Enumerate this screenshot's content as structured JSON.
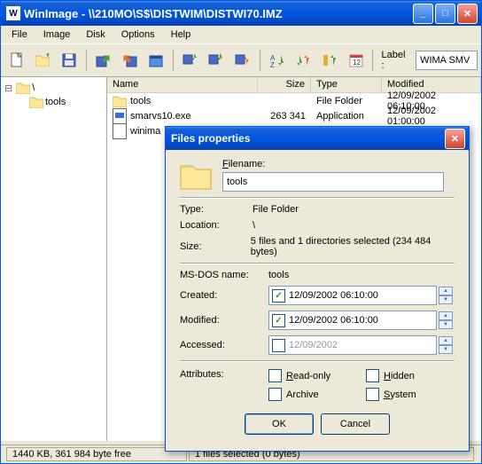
{
  "window": {
    "title": "WinImage - \\\\210MO\\S$\\DISTWIM\\DISTWI70.IMZ"
  },
  "menu": {
    "file": "File",
    "image": "Image",
    "disk": "Disk",
    "options": "Options",
    "help": "Help"
  },
  "toolbar": {
    "label_text": "Label :",
    "label_value": "WIMA SMV"
  },
  "tree": {
    "root": "\\",
    "child": "tools"
  },
  "list": {
    "headers": {
      "name": "Name",
      "size": "Size",
      "type": "Type",
      "modified": "Modified"
    },
    "rows": [
      {
        "name": "tools",
        "size": "",
        "type": "File Folder",
        "modified": "12/09/2002  06:10:00",
        "icon": "folder"
      },
      {
        "name": "smarvs10.exe",
        "size": "263 341",
        "type": "Application",
        "modified": "12/09/2002  01:00:00",
        "icon": "exe"
      },
      {
        "name": "winima",
        "size": "",
        "type": "",
        "modified": "",
        "icon": "imz"
      }
    ]
  },
  "status": {
    "left": "1440 KB, 361 984 byte free",
    "right": "1 files selected (0 bytes)"
  },
  "dialog": {
    "title": "Files properties",
    "filename_label": "Filename:",
    "filename_value": "tools",
    "type_label": "Type:",
    "type_value": "File Folder",
    "location_label": "Location:",
    "location_value": "\\",
    "size_label": "Size:",
    "size_value": "5 files and 1 directories selected (234 484 bytes)",
    "msdos_label": "MS-DOS name:",
    "msdos_value": "tools",
    "created_label": "Created:",
    "created_value": "12/09/2002 06:10:00",
    "modified_label": "Modified:",
    "modified_value": "12/09/2002 06:10:00",
    "accessed_label": "Accessed:",
    "accessed_value": "12/09/2002",
    "attributes_label": "Attributes:",
    "attr_readonly": "Read-only",
    "attr_hidden": "Hidden",
    "attr_archive": "Archive",
    "attr_system": "System",
    "ok": "OK",
    "cancel": "Cancel"
  }
}
